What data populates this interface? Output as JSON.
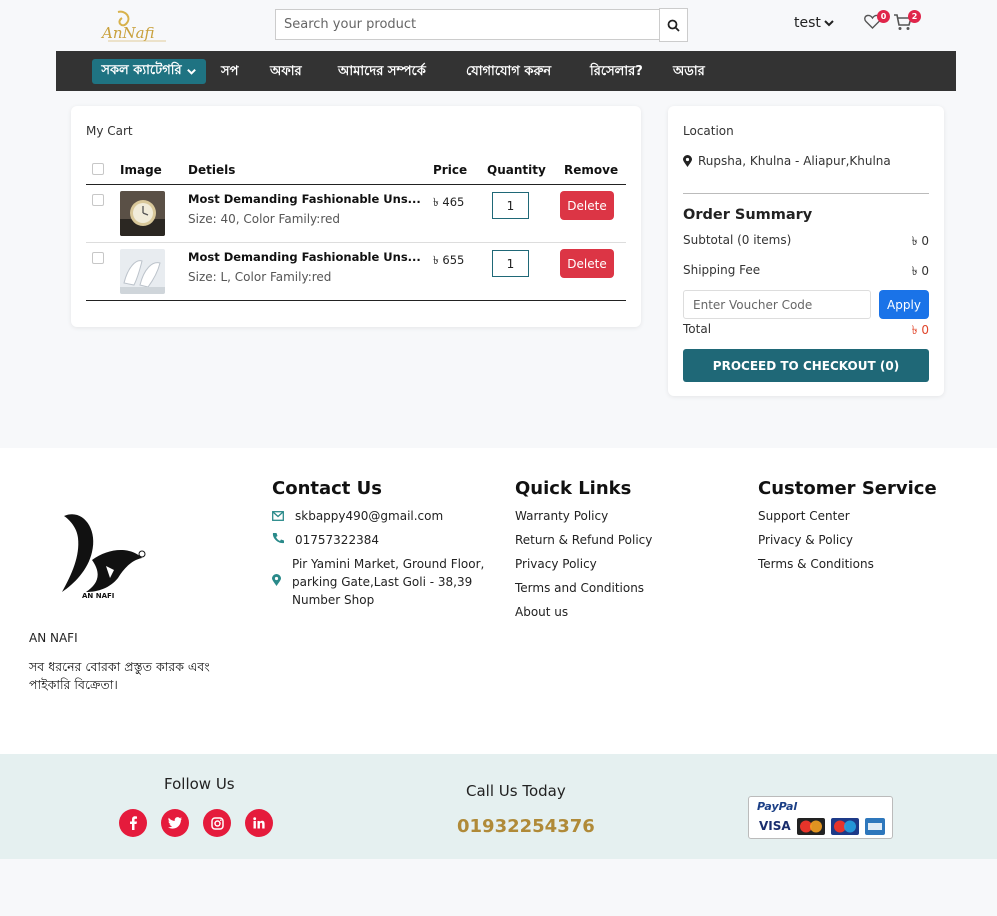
{
  "header": {
    "logo_text": "AnNafi",
    "search_placeholder": "Search your product",
    "user_label": "test",
    "wishlist_count": "0",
    "cart_count": "2"
  },
  "nav": {
    "category_label": "সকল ক্যাটেগরি",
    "links": [
      "সপ",
      "অফার",
      "আমাদের সম্পর্কে",
      "যোগাযোগ করুন",
      "রিসেলার?",
      "অডার"
    ]
  },
  "cart": {
    "title": "My Cart",
    "columns": {
      "image": "Image",
      "details": "Detiels",
      "price": "Price",
      "quantity": "Quantity",
      "remove": "Remove"
    },
    "items": [
      {
        "name": "Most Demanding Fashionable Uns...",
        "meta": "Size: 40, Color Family:red",
        "price": "৳ 465",
        "qty": "1",
        "delete_label": "Delete"
      },
      {
        "name": "Most Demanding Fashionable Uns...",
        "meta": "Size: L, Color Family:red",
        "price": "৳ 655",
        "qty": "1",
        "delete_label": "Delete"
      }
    ]
  },
  "summary": {
    "location_label": "Location",
    "location_value": "Rupsha, Khulna - Aliapur,Khulna",
    "title": "Order Summary",
    "subtotal_label": "Subtotal (0 items)",
    "subtotal_value": "৳ 0",
    "shipping_label": "Shipping Fee",
    "shipping_value": "৳ 0",
    "voucher_placeholder": "Enter Voucher Code",
    "apply_label": "Apply",
    "total_label": "Total",
    "total_value": "৳ 0",
    "checkout_label": "PROCEED TO CHECKOUT (0)"
  },
  "footer": {
    "brand_name": "AN NAFI",
    "logo_caption": "AN NAFI",
    "tagline": "সব ধরনের বোরকা প্রস্তুত কারক এবং পাইকারি বিক্রেতা।",
    "contact": {
      "title": "Contact Us",
      "email": "skbappy490@gmail.com",
      "phone": "01757322384",
      "address": "Pir Yamini Market, Ground Floor, parking Gate,Last Goli - 38,39 Number Shop"
    },
    "quick_links": {
      "title": "Quick Links",
      "items": [
        "Warranty Policy",
        "Return & Refund Policy",
        "Privacy Policy",
        "Terms and Conditions",
        "About us"
      ]
    },
    "customer_service": {
      "title": "Customer Service",
      "items": [
        "Support Center",
        "Privacy & Policy",
        "Terms & Conditions"
      ]
    }
  },
  "bottom": {
    "follow_title": "Follow Us",
    "call_title": "Call Us Today",
    "call_number": "01932254376",
    "social": [
      "f",
      "t",
      "ig",
      "in"
    ],
    "payment": {
      "paypal": "PayPal",
      "visa": "VISA",
      "maestro": "Maestro"
    }
  },
  "colors": {
    "primary": "#1f6877",
    "danger": "#dc3545",
    "accent_gold": "#b08a38",
    "social_red": "#e51b3c"
  }
}
